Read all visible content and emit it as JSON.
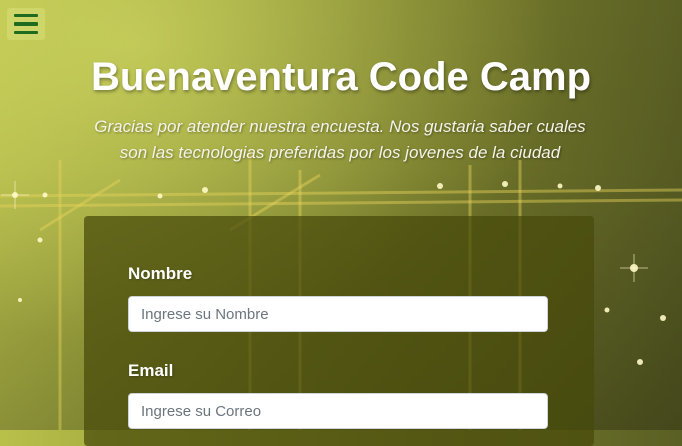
{
  "header": {
    "menu_icon": "hamburger-menu-icon",
    "title": "Buenaventura Code Camp",
    "subtitle": "Gracias por atender nuestra encuesta. Nos gustaria saber cuales son las tecnologias preferidas por los jovenes de la ciudad"
  },
  "form": {
    "name_label": "Nombre",
    "name_placeholder": "Ingrese su Nombre",
    "email_label": "Email",
    "email_placeholder": "Ingrese su Correo"
  },
  "colors": {
    "menu_icon": "#1f6b1f",
    "card_background": "#464a0a"
  }
}
